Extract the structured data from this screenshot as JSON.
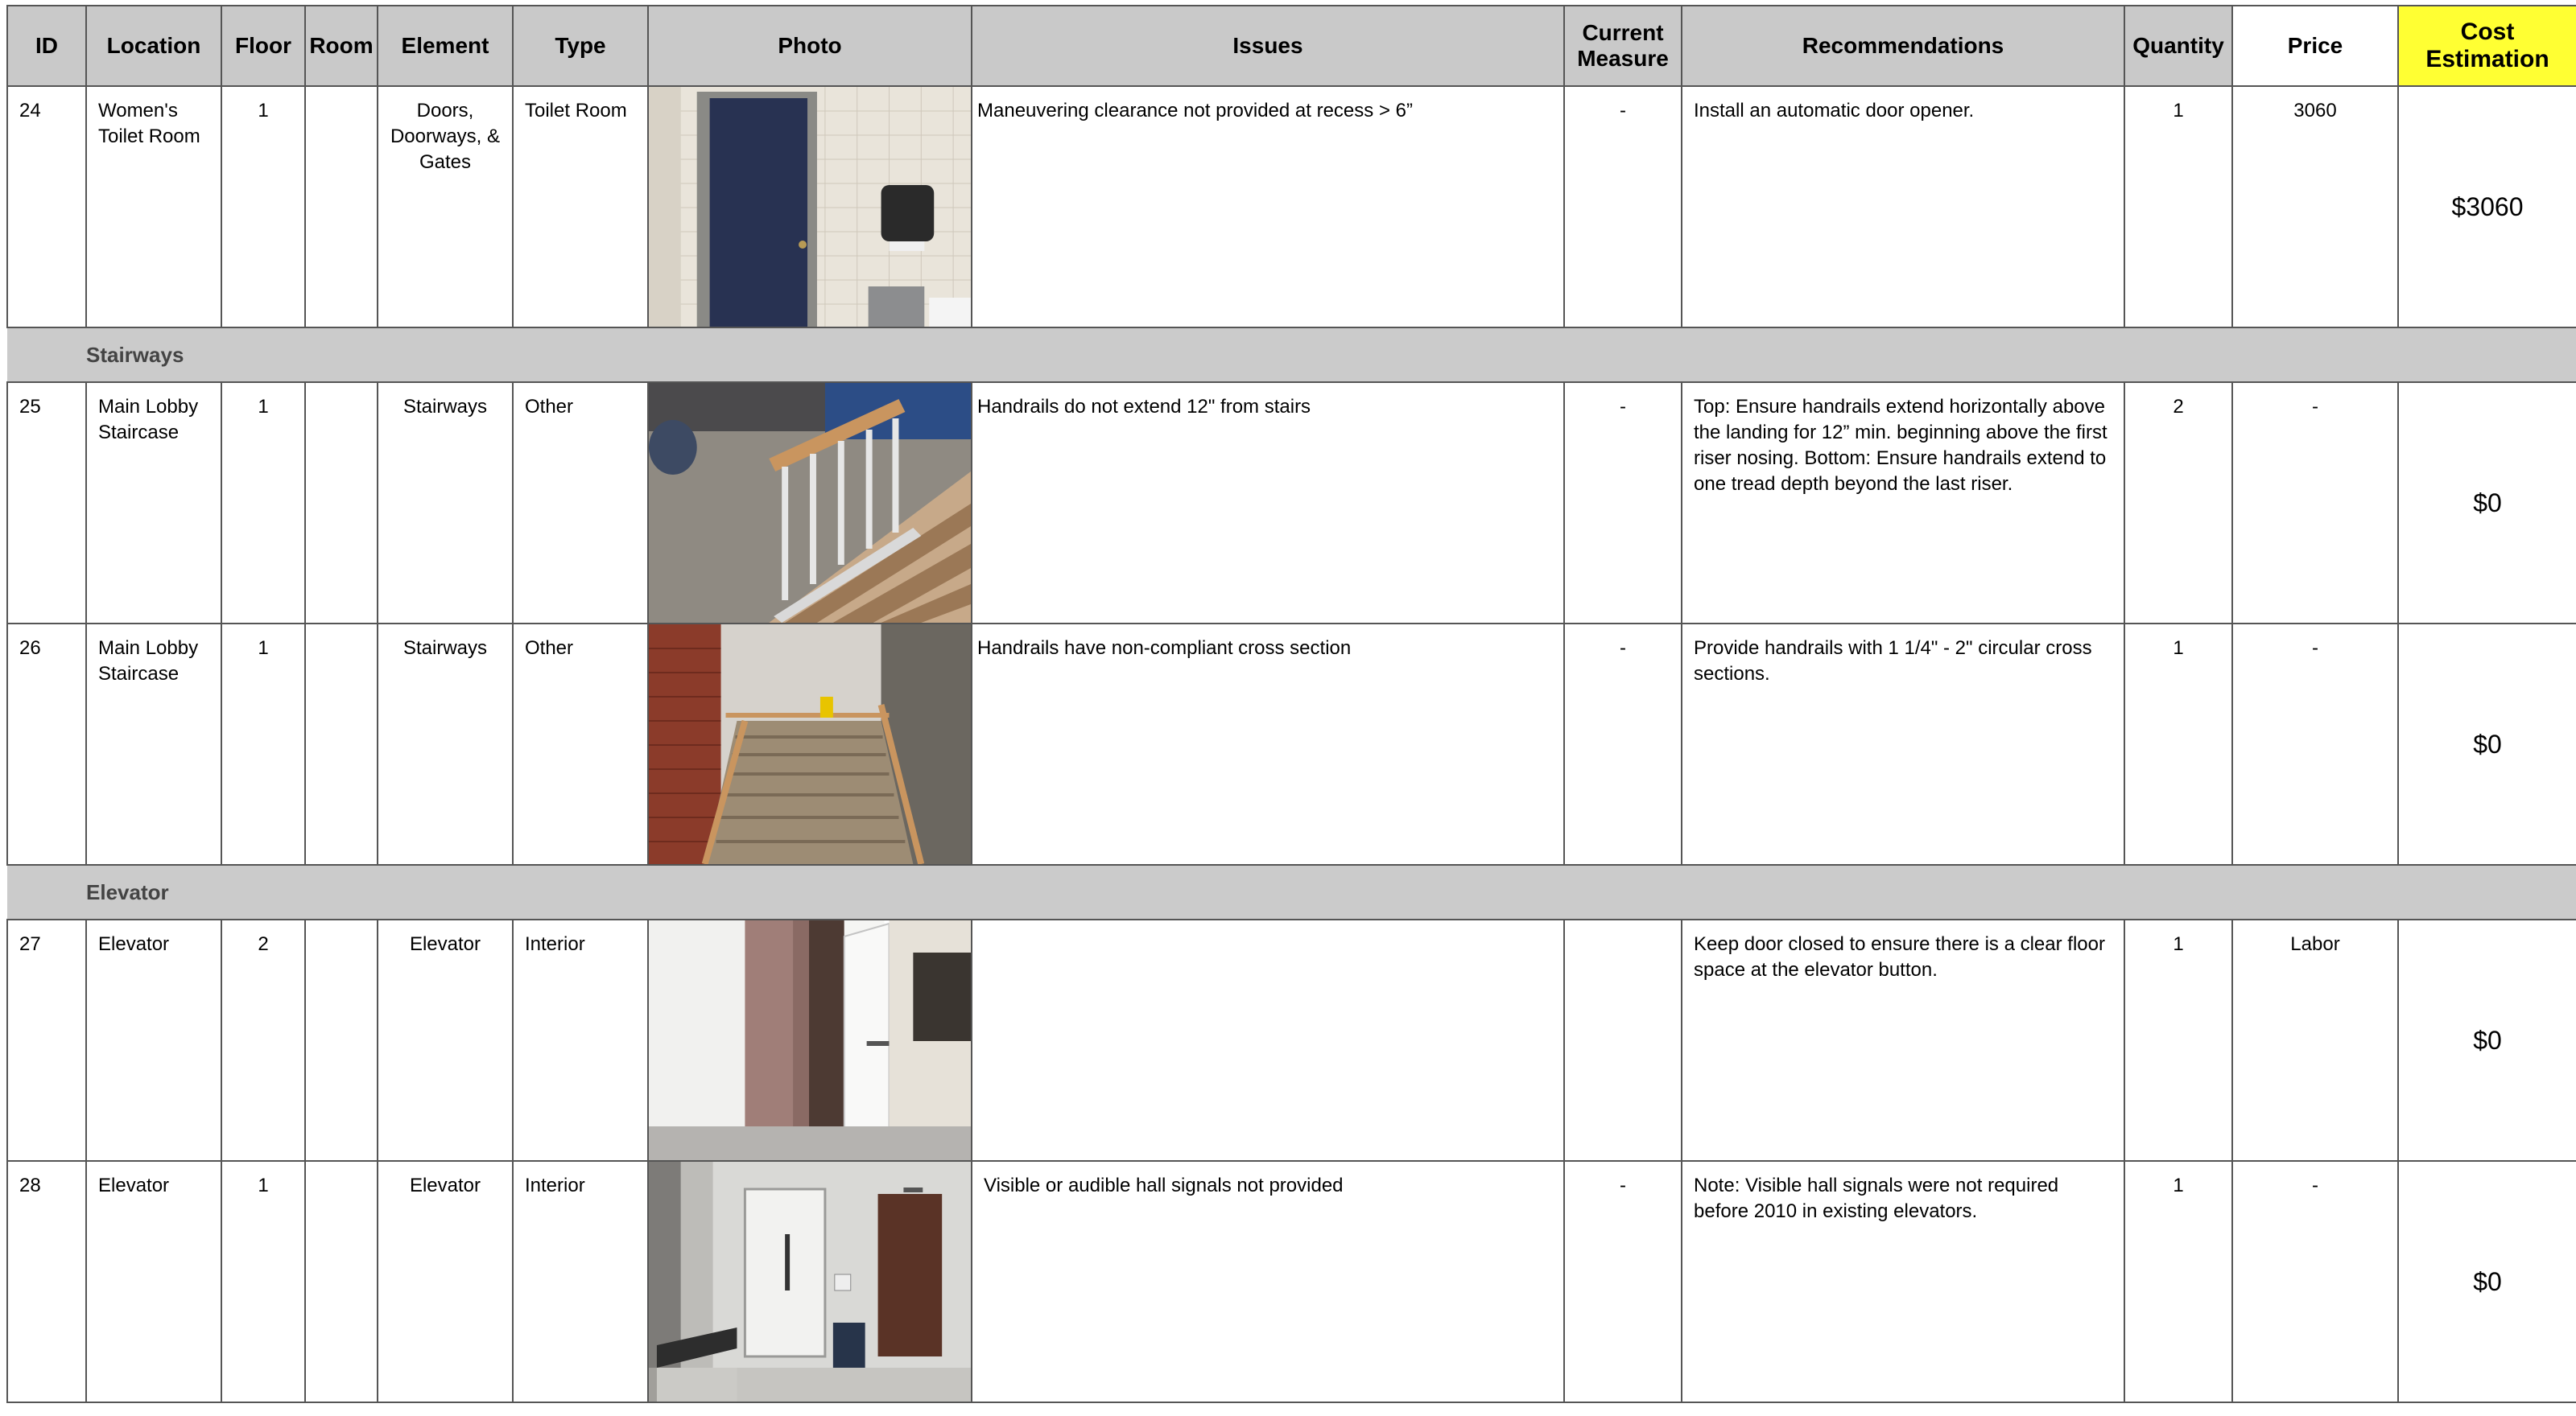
{
  "columns": {
    "id": "ID",
    "location": "Location",
    "floor": "Floor",
    "room": "Room",
    "element": "Element",
    "type": "Type",
    "photo": "Photo",
    "issues": "Issues",
    "current_measure": "Current Measure",
    "recommendations": "Recommendations",
    "quantity": "Quantity",
    "price": "Price",
    "cost_estimation": "Cost Estimation"
  },
  "colors": {
    "header_bg": "#c9c9c9",
    "cost_header_bg": "#ffff33",
    "section_bg": "#cbcbcb"
  },
  "rows": [
    {
      "id": "24",
      "location": "Women's Toilet Room",
      "floor": "1",
      "room": "",
      "element": "Doors, Doorways, & Gates",
      "type": "Toilet Room",
      "photo_subject": "navy-door-with-paper-towel-dispenser",
      "issues": "Maneuvering clearance not provided at recess > 6”",
      "current_measure": "-",
      "recommendations": "Install an automatic door opener.",
      "quantity": "1",
      "price": "3060",
      "cost": "$3060"
    }
  ],
  "section_stairways": "Stairways",
  "rows_stairways": [
    {
      "id": "25",
      "location": "Main Lobby Staircase",
      "floor": "1",
      "room": "",
      "element": "Stairways",
      "type": "Other",
      "photo_subject": "stair-handrail",
      "issues": "Handrails do not extend 12\" from stairs",
      "current_measure": "-",
      "recommendations": "Top: Ensure handrails extend horizontally above the landing for 12” min. beginning above the first riser nosing. Bottom: Ensure handrails extend to one tread depth beyond the last riser.",
      "quantity": "2",
      "price": "-",
      "cost": "$0"
    },
    {
      "id": "26",
      "location": "Main Lobby Staircase",
      "floor": "1",
      "room": "",
      "element": "Stairways",
      "type": "Other",
      "photo_subject": "staircase-with-wood-handrail",
      "issues": "Handrails have non-compliant cross section",
      "current_measure": "-",
      "recommendations": "Provide handrails with 1 1/4\" - 2\"  circular cross sections.",
      "quantity": "1",
      "price": "-",
      "cost": "$0"
    }
  ],
  "section_elevator": "Elevator",
  "rows_elevator": [
    {
      "id": "27",
      "location": "Elevator",
      "floor": "2",
      "room": "",
      "element": "Elevator",
      "type": "Interior",
      "photo_subject": "elevator-with-open-door",
      "issues": "",
      "current_measure": "",
      "recommendations": "Keep door closed to ensure there is a clear floor space at the elevator button.",
      "quantity": "1",
      "price": "Labor",
      "cost": "$0"
    },
    {
      "id": "28",
      "location": "Elevator",
      "floor": "1",
      "room": "",
      "element": "Elevator",
      "type": "Interior",
      "photo_subject": "elevator-lobby",
      "issues": "Visible or audible hall signals not provided",
      "current_measure": "-",
      "recommendations": "Note: Visible hall signals were not required before 2010 in existing elevators.",
      "quantity": "1",
      "price": "-",
      "cost": "$0"
    }
  ]
}
